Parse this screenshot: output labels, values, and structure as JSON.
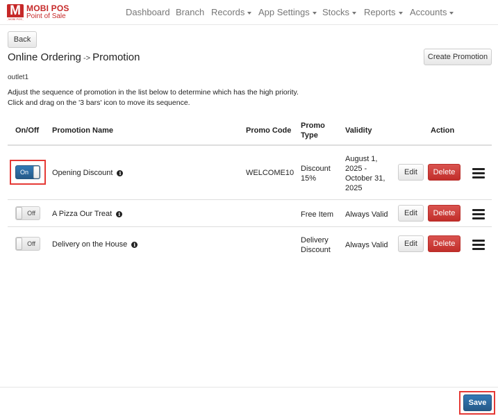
{
  "brand": {
    "logo_letter": "M",
    "logo_sub": "MOBI POS",
    "name": "MOBI POS",
    "tagline": "Point of Sale"
  },
  "nav": {
    "dashboard": "Dashboard",
    "branch": "Branch",
    "records": "Records",
    "app_settings": "App Settings",
    "stocks": "Stocks",
    "reports": "Reports",
    "accounts": "Accounts"
  },
  "page": {
    "back_label": "Back",
    "title_left": "Online Ordering",
    "title_arrow": "->",
    "title_right": "Promotion",
    "create_label": "Create Promotion",
    "outlet": "outlet1",
    "instruction_1": "Adjust the sequence of promotion in the list below to determine which has the high priority.",
    "instruction_2": "Click and drag on the '3 bars' icon to move its sequence.",
    "save_label": "Save"
  },
  "table": {
    "headers": {
      "onoff": "On/Off",
      "name": "Promotion Name",
      "code": "Promo Code",
      "type_1": "Promo",
      "type_2": "Type",
      "validity": "Validity",
      "action": "Action"
    },
    "edit_label": "Edit",
    "delete_label": "Delete",
    "rows": [
      {
        "toggle": "On",
        "name": "Opening Discount",
        "code": "WELCOME10",
        "type_1": "Discount",
        "type_2": "15%",
        "validity_1": "August 1,",
        "validity_2": "2025 -",
        "validity_3": "October 31,",
        "validity_4": "2025"
      },
      {
        "toggle": "Off",
        "name": "A Pizza Our Treat",
        "code": "",
        "type_1": "Free Item",
        "type_2": "",
        "validity_1": "Always Valid"
      },
      {
        "toggle": "Off",
        "name": "Delivery on the House",
        "code": "",
        "type_1": "Delivery",
        "type_2": "Discount",
        "validity_1": "Always Valid"
      }
    ]
  },
  "colors": {
    "brand_red": "#c62828",
    "primary": "#337ab7",
    "danger": "#d9534f",
    "highlight": "#e53935"
  }
}
